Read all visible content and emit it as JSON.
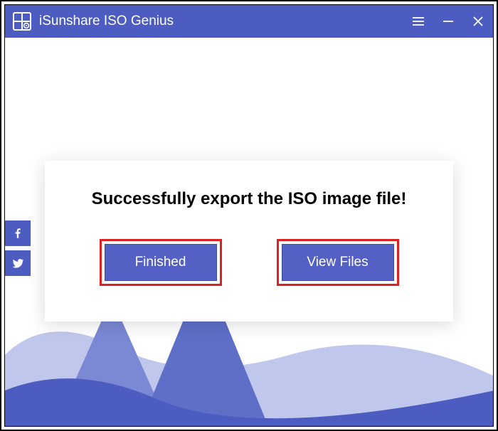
{
  "app": {
    "title": "iSunshare ISO Genius"
  },
  "titlebar": {
    "menu_icon": "hamburger-menu-icon",
    "minimize_icon": "minimize-icon",
    "close_icon": "close-icon"
  },
  "social": {
    "facebook_icon": "facebook-icon",
    "twitter_icon": "twitter-icon"
  },
  "dialog": {
    "message": "Successfully export the ISO image file!",
    "buttons": {
      "finished": "Finished",
      "view_files": "View Files"
    }
  },
  "colors": {
    "primary": "#4d5cc0",
    "button": "#5460c4",
    "highlight_border": "#dd2020",
    "mountain_light": "#bfc8ec",
    "mountain_mid": "#7b88d4"
  }
}
